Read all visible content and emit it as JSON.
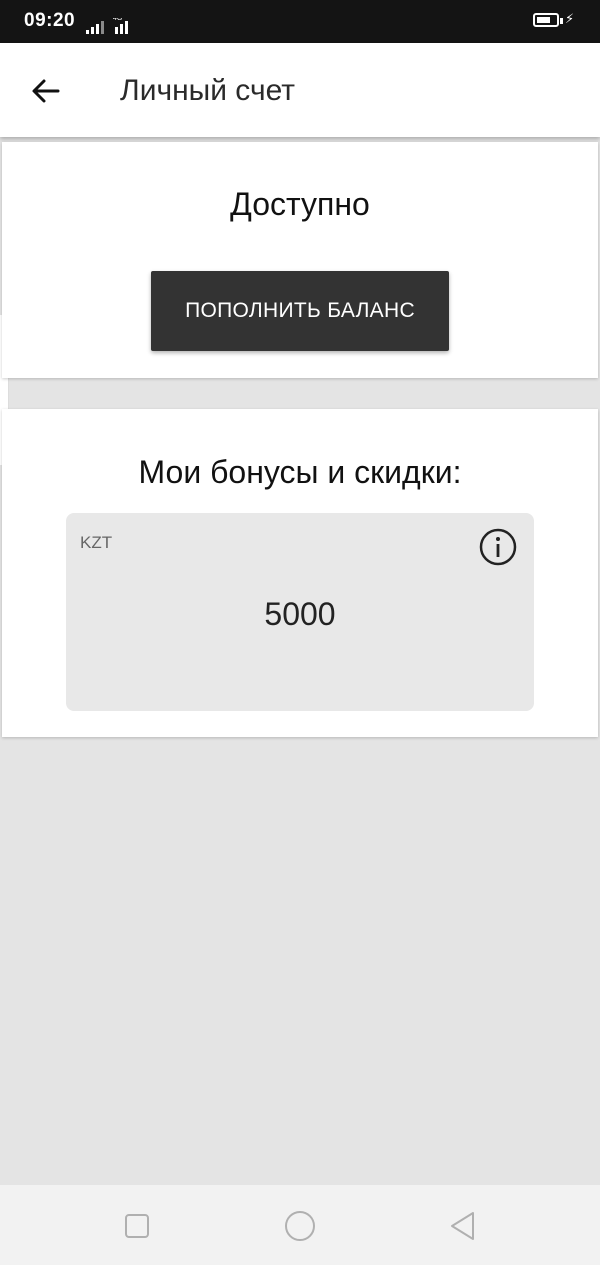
{
  "status_bar": {
    "time": "09:20",
    "network": "4G"
  },
  "header": {
    "title": "Личный счет",
    "back_icon": "arrow-left-icon"
  },
  "balance_card": {
    "available_label": "Доступно",
    "topup_button_label": "ПОПОЛНИТЬ БАЛАНС"
  },
  "bonuses_card": {
    "title": "Мои бонусы и скидки:",
    "currency": "KZT",
    "amount": "5000",
    "info_icon": "info-icon"
  },
  "nav_bar": {
    "items": [
      "recent-apps-icon",
      "home-icon",
      "back-triangle-icon"
    ]
  },
  "colors": {
    "button_bg": "#333333",
    "page_bg": "#e4e4e4",
    "bonus_card_bg": "#e8e8e8"
  }
}
